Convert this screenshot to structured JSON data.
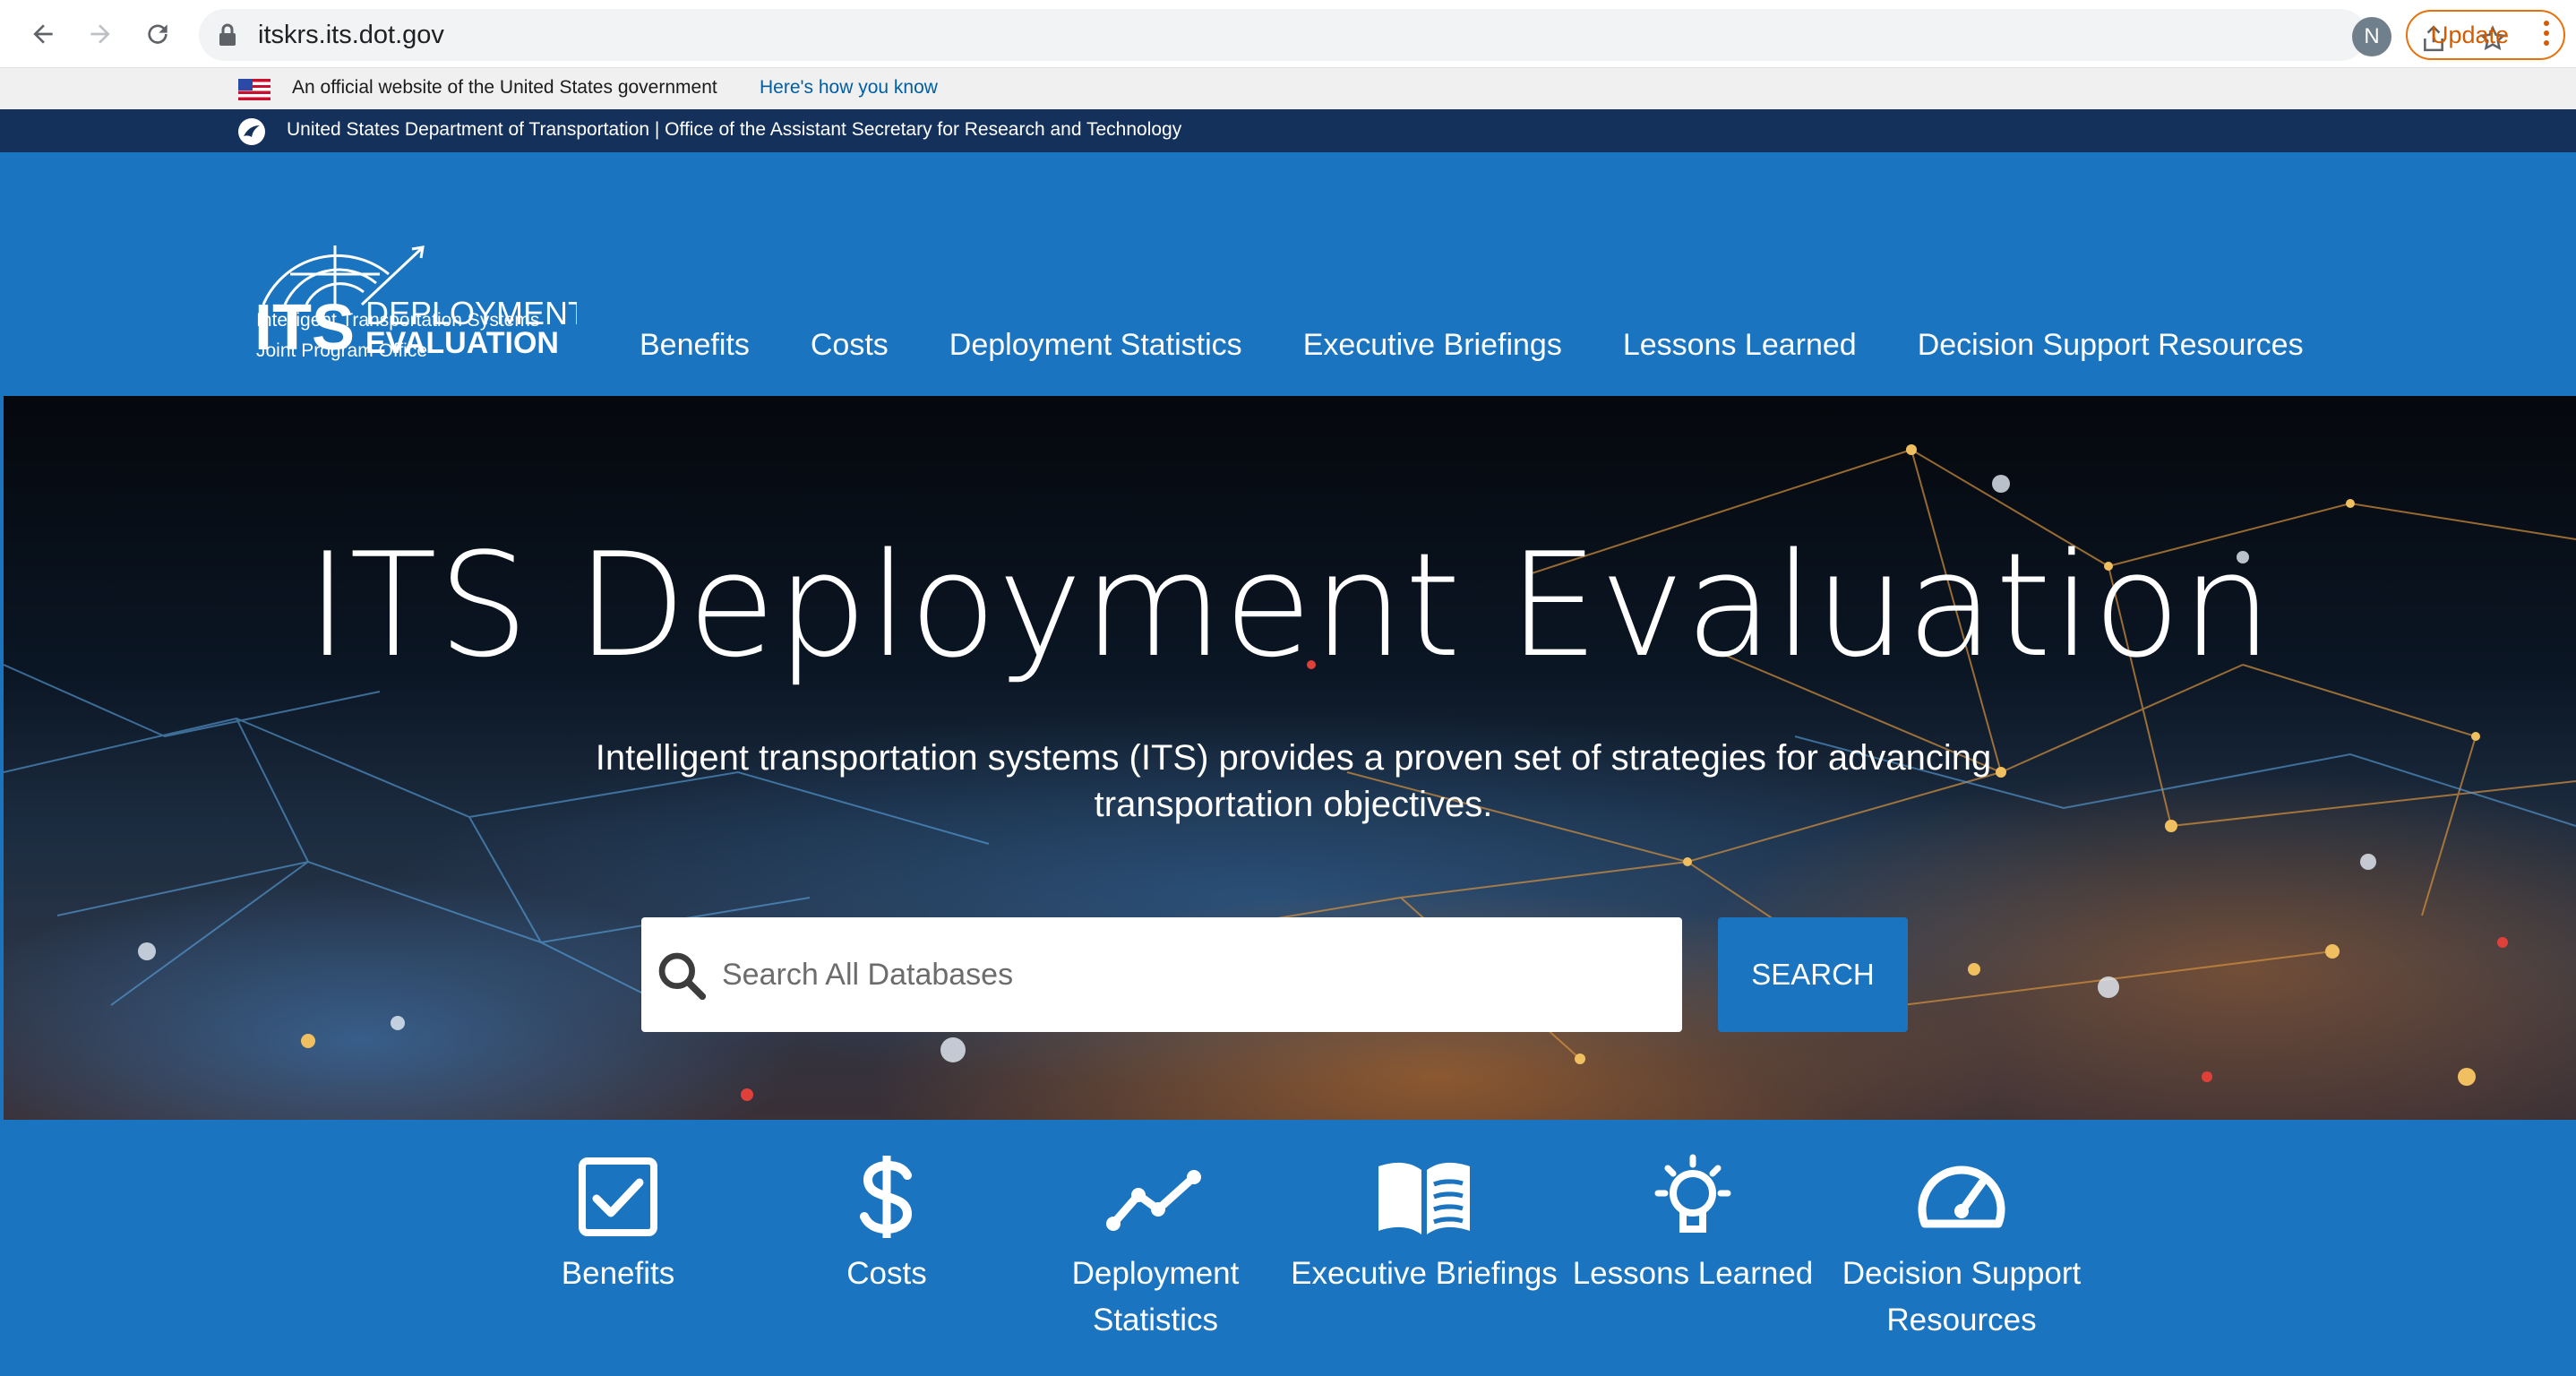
{
  "browser": {
    "url": "itskrs.its.dot.gov",
    "profile_initial": "N",
    "update_label": "Update"
  },
  "gov_banner": {
    "text": "An official website of the United States government",
    "link": "Here's how you know"
  },
  "dot_bar": {
    "text": "United States Department of Transportation | Office of the Assistant Secretary for Research and Technology"
  },
  "header": {
    "logo_lines": [
      "ITS",
      "DEPLOYMENT",
      "EVALUATION"
    ],
    "subtitle_1": "Intelligent Transportation Systems",
    "subtitle_2": "Joint Program Office",
    "nav": [
      "Benefits",
      "Costs",
      "Deployment Statistics",
      "Executive Briefings",
      "Lessons Learned",
      "Decision Support Resources"
    ]
  },
  "hero": {
    "title": "ITS Deployment Evaluation",
    "subtitle": "Intelligent transportation systems (ITS) provides a proven set of strategies for advancing transportation objectives.",
    "search_placeholder": "Search All Databases",
    "search_button": "SEARCH"
  },
  "features": [
    {
      "icon": "checkbox-icon",
      "line1": "Benefits",
      "line2": ""
    },
    {
      "icon": "dollar-icon",
      "line1": "Costs",
      "line2": ""
    },
    {
      "icon": "trend-line-icon",
      "line1": "Deployment",
      "line2": "Statistics"
    },
    {
      "icon": "open-book-icon",
      "line1": "Executive Briefings",
      "line2": ""
    },
    {
      "icon": "lightbulb-icon",
      "line1": "Lessons Learned",
      "line2": ""
    },
    {
      "icon": "gauge-icon",
      "line1": "Decision Support",
      "line2": "Resources"
    }
  ],
  "colors": {
    "brand_blue": "#1a74c0",
    "dot_navy": "#14315c",
    "update_orange": "#e8710a"
  }
}
